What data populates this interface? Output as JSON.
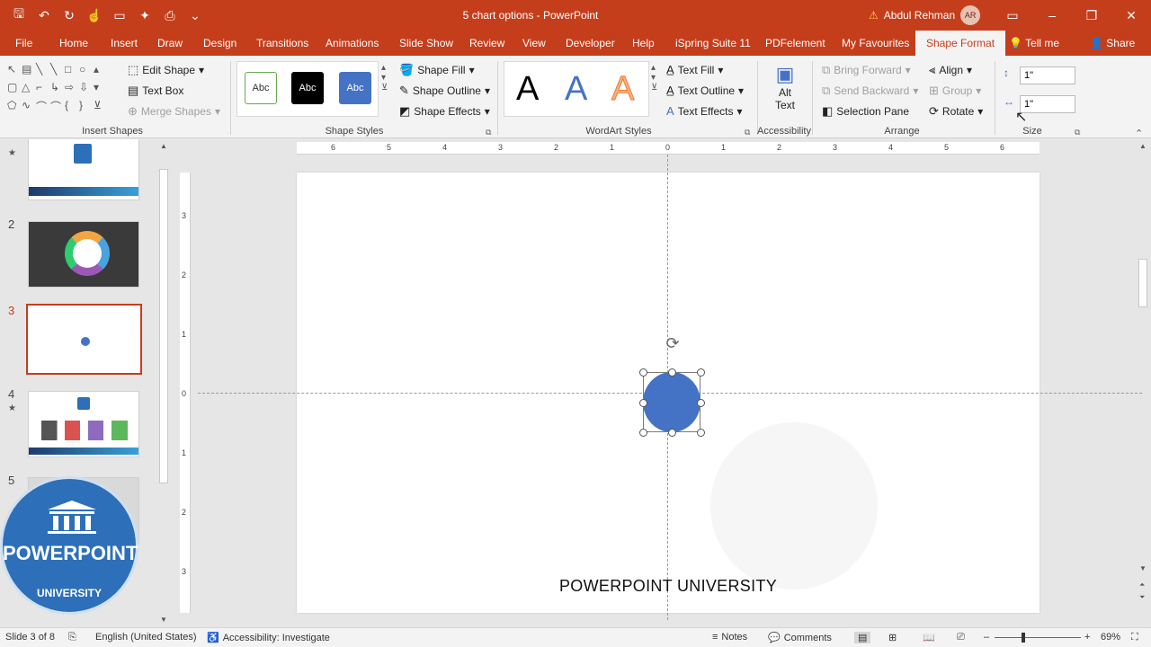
{
  "window": {
    "title": "5 chart options  -  PowerPoint",
    "user_name": "Abdul Rehman",
    "user_initials": "AR"
  },
  "tabs": [
    "File",
    "Home",
    "Insert",
    "Draw",
    "Design",
    "Transitions",
    "Animations",
    "Slide Show",
    "Review",
    "View",
    "Developer",
    "Help",
    "iSpring Suite 11",
    "PDFelement",
    "My Favourites",
    "Shape Format"
  ],
  "tell_me": "Tell me",
  "share": "Share",
  "ribbon": {
    "insert_shapes": {
      "label": "Insert Shapes",
      "edit_shape": "Edit Shape",
      "text_box": "Text Box",
      "merge_shapes": "Merge Shapes"
    },
    "shape_styles": {
      "label": "Shape Styles",
      "sample": "Abc",
      "fill": "Shape Fill",
      "outline": "Shape Outline",
      "effects": "Shape Effects"
    },
    "wordart": {
      "label": "WordArt Styles",
      "letter": "A",
      "text_fill": "Text Fill",
      "text_outline": "Text Outline",
      "text_effects": "Text Effects"
    },
    "accessibility": {
      "label": "Accessibility",
      "alt_text_1": "Alt",
      "alt_text_2": "Text"
    },
    "arrange": {
      "label": "Arrange",
      "bring_forward": "Bring Forward",
      "send_backward": "Send Backward",
      "selection_pane": "Selection Pane",
      "align": "Align",
      "group": "Group",
      "rotate": "Rotate"
    },
    "size": {
      "label": "Size",
      "height": "1\"",
      "width": "1\""
    }
  },
  "slides": [
    {
      "num": "",
      "star": true
    },
    {
      "num": "2",
      "star": false
    },
    {
      "num": "3",
      "star": false
    },
    {
      "num": "4",
      "star": true
    },
    {
      "num": "5",
      "star": false
    }
  ],
  "ruler_h": [
    "6",
    "5",
    "4",
    "3",
    "2",
    "1",
    "0",
    "1",
    "2",
    "3",
    "4",
    "5",
    "6"
  ],
  "ruler_v": [
    "3",
    "2",
    "1",
    "0",
    "1",
    "2",
    "3"
  ],
  "slide": {
    "footer": "POWERPOINT UNIVERSITY",
    "shape_color": "#4472c4"
  },
  "logo": {
    "line1": "POWERPOINT",
    "line2": "UNIVERSITY"
  },
  "status": {
    "slide": "Slide 3 of 8",
    "language": "English (United States)",
    "accessibility": "Accessibility: Investigate",
    "notes": "Notes",
    "comments": "Comments",
    "zoom": "69%"
  },
  "colors": {
    "accent": "#c43e1c",
    "shape": "#4472c4"
  }
}
